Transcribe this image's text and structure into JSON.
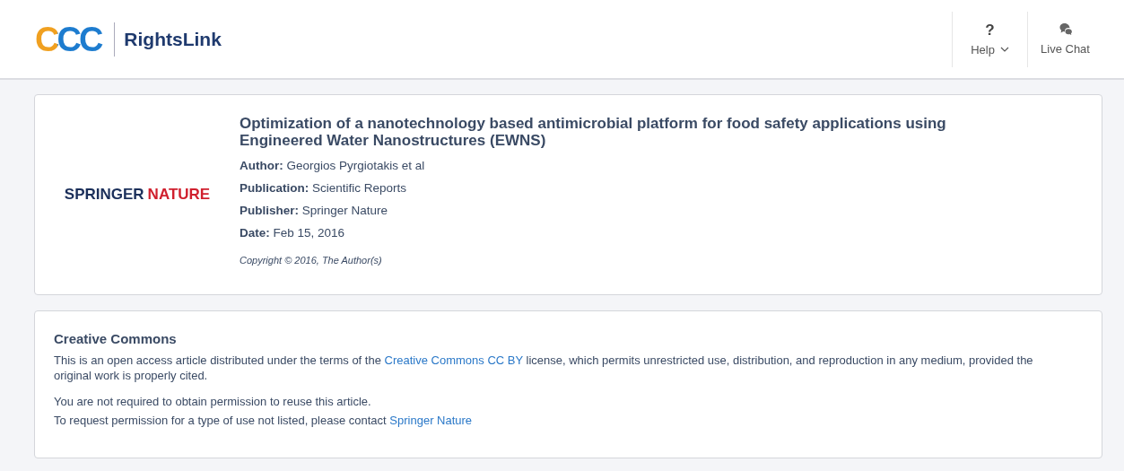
{
  "header": {
    "logo_mark": "CCC",
    "product": "RightsLink",
    "actions": [
      {
        "kind": "help",
        "icon": "?",
        "label": "Help"
      },
      {
        "kind": "chat",
        "label": "Live Chat"
      }
    ]
  },
  "article": {
    "publisher_logo": [
      "SPRINGER",
      "NATURE"
    ],
    "title": "Optimization of a nanotechnology based antimicrobial platform for food safety applications using Engineered Water Nanostructures (EWNS)",
    "fields": [
      {
        "label": "Author:",
        "value": "Georgios Pyrgiotakis et al"
      },
      {
        "label": "Publication:",
        "value": "Scientific Reports"
      },
      {
        "label": "Publisher:",
        "value": "Springer Nature"
      },
      {
        "label": "Date:",
        "value": "Feb 15, 2016"
      }
    ],
    "copyright": "Copyright © 2016, The Author(s)"
  },
  "license": {
    "heading": "Creative Commons",
    "paragraphs": [
      {
        "before": "This is an open access article distributed under the terms of the ",
        "link": "Creative Commons CC BY",
        "after": " license, which permits unrestricted use, distribution, and reproduction in any medium, provided the original work is properly cited."
      },
      {
        "before": "You are not required to obtain permission to reuse this article."
      },
      {
        "before": "To request permission for a type of use not listed, please contact ",
        "link": "Springer Nature"
      }
    ]
  }
}
